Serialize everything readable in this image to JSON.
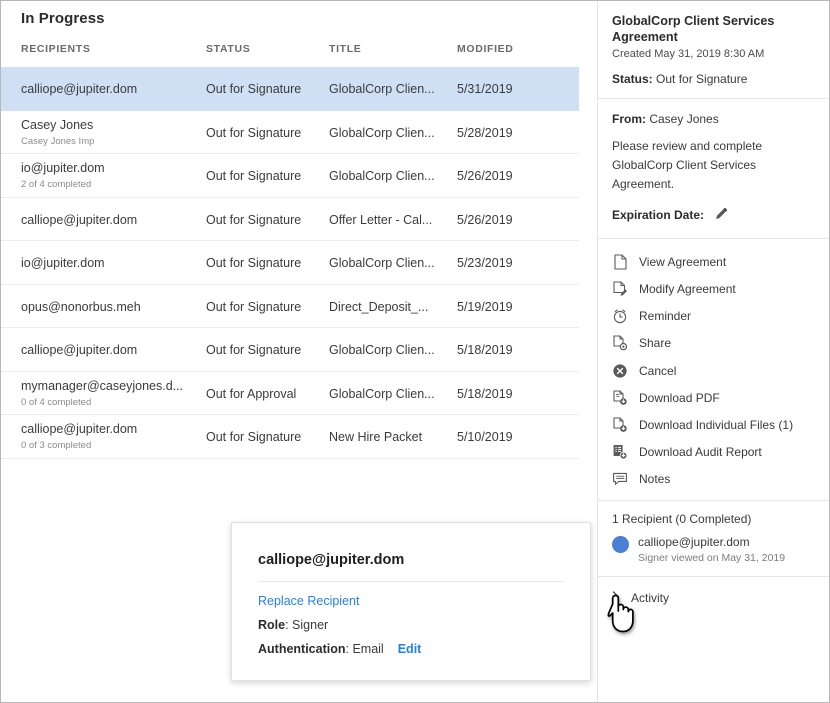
{
  "page": {
    "title": "In Progress"
  },
  "table": {
    "columns": [
      "RECIPIENTS",
      "STATUS",
      "TITLE",
      "MODIFIED"
    ],
    "rows": [
      {
        "recipient": "calliope@jupiter.dom",
        "sub": "",
        "status": "Out for Signature",
        "title": "GlobalCorp Clien...",
        "modified": "5/31/2019",
        "selected": true
      },
      {
        "recipient": "Casey Jones",
        "sub": "Casey Jones Imp",
        "status": "Out for Signature",
        "title": "GlobalCorp Clien...",
        "modified": "5/28/2019",
        "selected": false
      },
      {
        "recipient": "io@jupiter.dom",
        "sub": "2 of 4 completed",
        "status": "Out for Signature",
        "title": "GlobalCorp Clien...",
        "modified": "5/26/2019",
        "selected": false
      },
      {
        "recipient": "calliope@jupiter.dom",
        "sub": "",
        "status": "Out for Signature",
        "title": "Offer Letter - Cal...",
        "modified": "5/26/2019",
        "selected": false
      },
      {
        "recipient": "io@jupiter.dom",
        "sub": "",
        "status": "Out for Signature",
        "title": "GlobalCorp Clien...",
        "modified": "5/23/2019",
        "selected": false
      },
      {
        "recipient": "opus@nonorbus.meh",
        "sub": "",
        "status": "Out for Signature",
        "title": "Direct_Deposit_...",
        "modified": "5/19/2019",
        "selected": false
      },
      {
        "recipient": "calliope@jupiter.dom",
        "sub": "",
        "status": "Out for Signature",
        "title": "GlobalCorp Clien...",
        "modified": "5/18/2019",
        "selected": false
      },
      {
        "recipient": "mymanager@caseyjones.d...",
        "sub": "0 of 4 completed",
        "status": "Out for Approval",
        "title": "GlobalCorp Clien...",
        "modified": "5/18/2019",
        "selected": false
      },
      {
        "recipient": "calliope@jupiter.dom",
        "sub": "0 of 3 completed",
        "status": "Out for Signature",
        "title": "New Hire Packet",
        "modified": "5/10/2019",
        "selected": false
      }
    ]
  },
  "detail": {
    "doc_title": "GlobalCorp Client Services Agreement",
    "created": "Created May 31, 2019 8:30 AM",
    "status_label": "Status:",
    "status_value": "Out for Signature",
    "from_label": "From:",
    "from_value": "Casey Jones",
    "message": "Please review and complete GlobalCorp Client Services Agreement.",
    "expiration_label": "Expiration Date:",
    "expiration_icon": "pencil-icon",
    "actions": [
      {
        "label": "View Agreement",
        "icon": "document-icon"
      },
      {
        "label": "Modify Agreement",
        "icon": "document-edit-icon"
      },
      {
        "label": "Reminder",
        "icon": "alarm-clock-icon"
      },
      {
        "label": "Share",
        "icon": "document-share-icon"
      },
      {
        "label": "Cancel",
        "icon": "cancel-circle-icon"
      },
      {
        "label": "Download PDF",
        "icon": "pdf-download-icon"
      },
      {
        "label": "Download Individual Files (1)",
        "icon": "file-download-icon"
      },
      {
        "label": "Download Audit Report",
        "icon": "report-download-icon"
      },
      {
        "label": "Notes",
        "icon": "comment-icon"
      }
    ],
    "recipients_heading": "1 Recipient (0 Completed)",
    "recipient": {
      "email": "calliope@jupiter.dom",
      "sub": "Signer viewed on May 31, 2019"
    },
    "activity_label": "Activity",
    "activity_icon": "chevron-right-icon"
  },
  "popup": {
    "title": "calliope@jupiter.dom",
    "replace_link": "Replace Recipient",
    "role_label": "Role",
    "role_value": "Signer",
    "auth_label": "Authentication",
    "auth_value": "Email",
    "edit_link": "Edit"
  },
  "colors": {
    "selected_row": "#cfe0f5",
    "link": "#2680eb",
    "avatar": "#4a7fd4",
    "text": "#3b3b3b"
  }
}
